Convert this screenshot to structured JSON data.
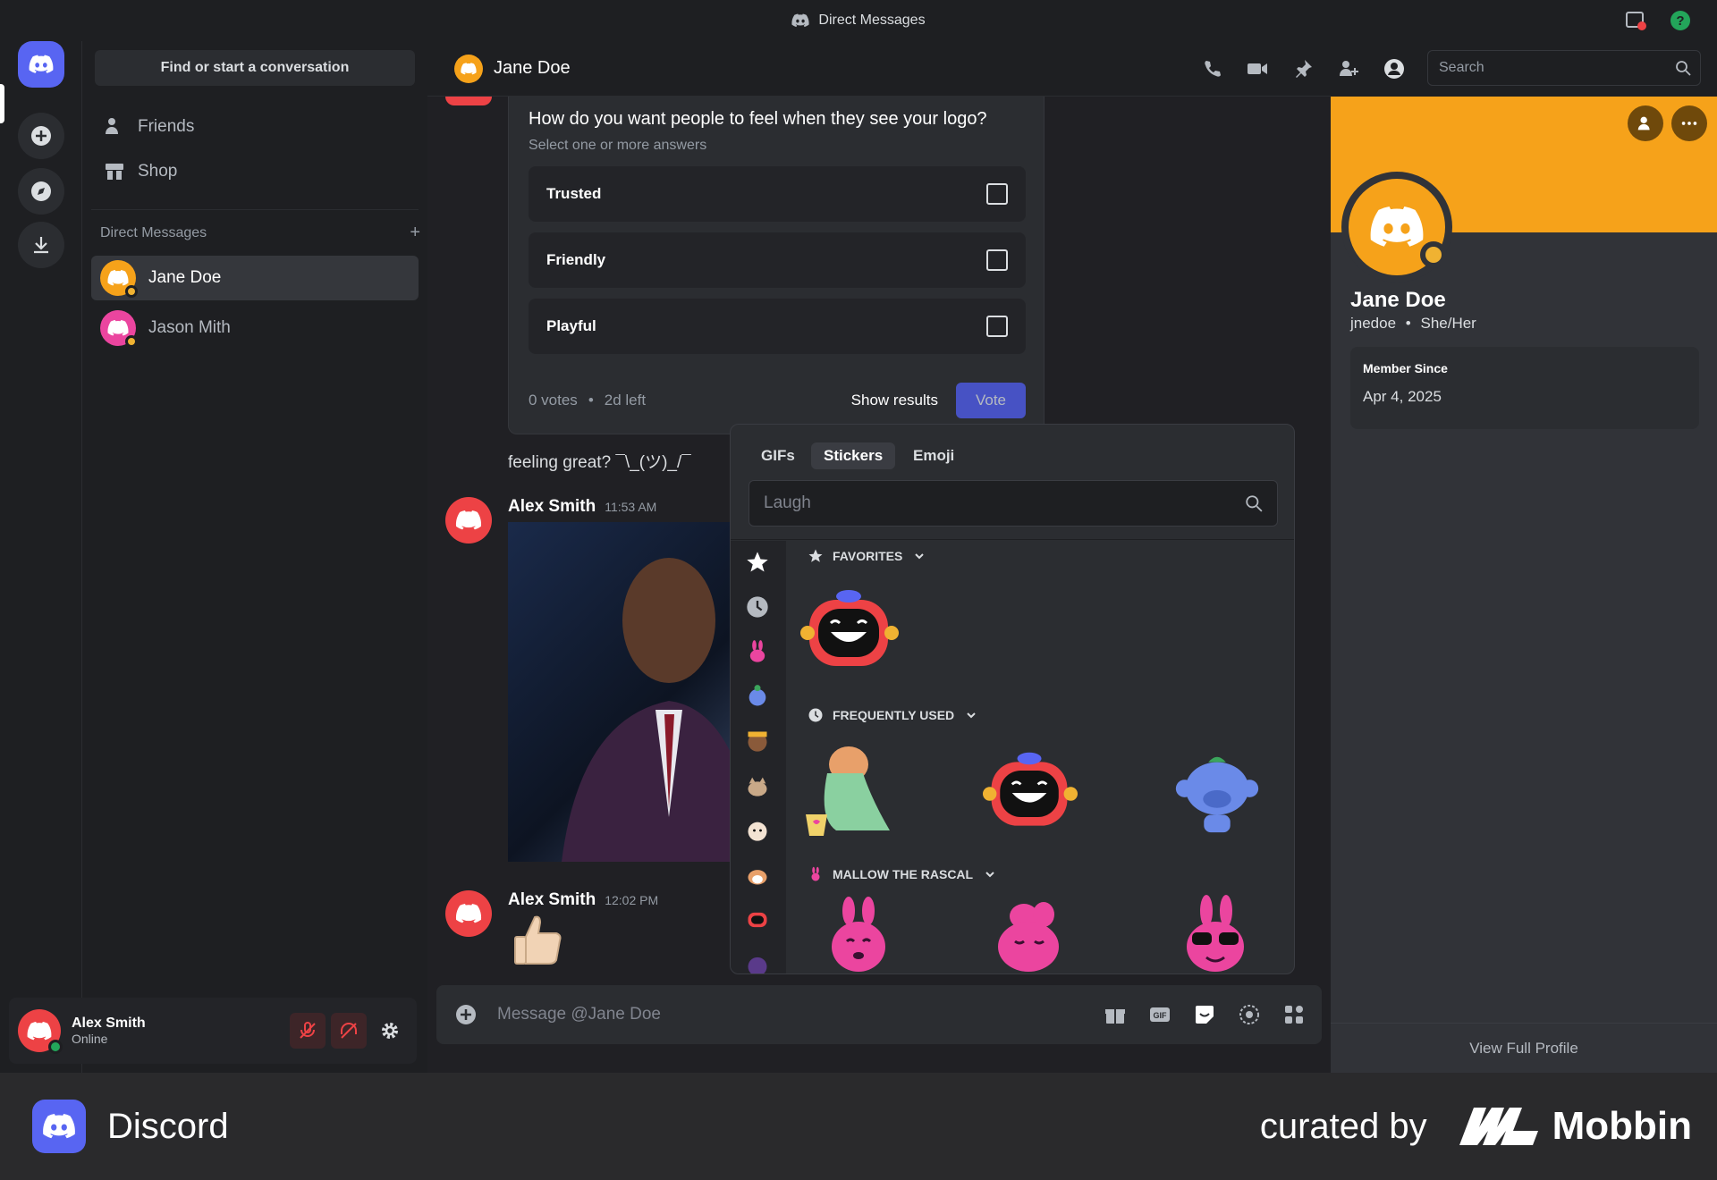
{
  "titlebar": {
    "title": "Direct Messages"
  },
  "sidebar": {
    "find_label": "Find or start a conversation",
    "nav": [
      {
        "label": "Friends",
        "icon": "friends-icon"
      },
      {
        "label": "Shop",
        "icon": "shop-icon"
      }
    ],
    "dm_header": "Direct Messages",
    "dms": [
      {
        "name": "Jane Doe",
        "avatar_color": "#f6a21a",
        "active": true
      },
      {
        "name": "Jason Mith",
        "avatar_color": "#eb459f",
        "active": false
      }
    ]
  },
  "user": {
    "name": "Alex Smith",
    "status": "Online"
  },
  "chat": {
    "recipient": "Jane Doe",
    "search_placeholder": "Search",
    "poll": {
      "question": "How do you want people to feel when they see your logo?",
      "subtitle": "Select one or more answers",
      "options": [
        "Trusted",
        "Friendly",
        "Playful"
      ],
      "votes": "0 votes",
      "time_left": "2d left",
      "show_results": "Show results",
      "vote": "Vote"
    },
    "messages": [
      {
        "text": "feeling great? ¯\\_(ツ)_/¯"
      },
      {
        "author": "Alex Smith",
        "time": "11:53 AM"
      },
      {
        "author": "Alex Smith",
        "time": "12:02 PM"
      }
    ],
    "message_placeholder": "Message @Jane Doe"
  },
  "picker": {
    "tabs": [
      "GIFs",
      "Stickers",
      "Emoji"
    ],
    "active_tab": "Stickers",
    "search_value": "Laugh",
    "sections": [
      "FAVORITES",
      "FREQUENTLY USED",
      "MALLOW THE RASCAL"
    ]
  },
  "profile": {
    "name": "Jane Doe",
    "username": "jnedoe",
    "pronouns": "She/Her",
    "member_label": "Member Since",
    "member_date": "Apr 4, 2025",
    "view_full": "View Full Profile",
    "banner_color": "#f6a21a"
  },
  "brand": {
    "app": "Discord",
    "curated": "curated by",
    "mobbin": "Mobbin"
  }
}
